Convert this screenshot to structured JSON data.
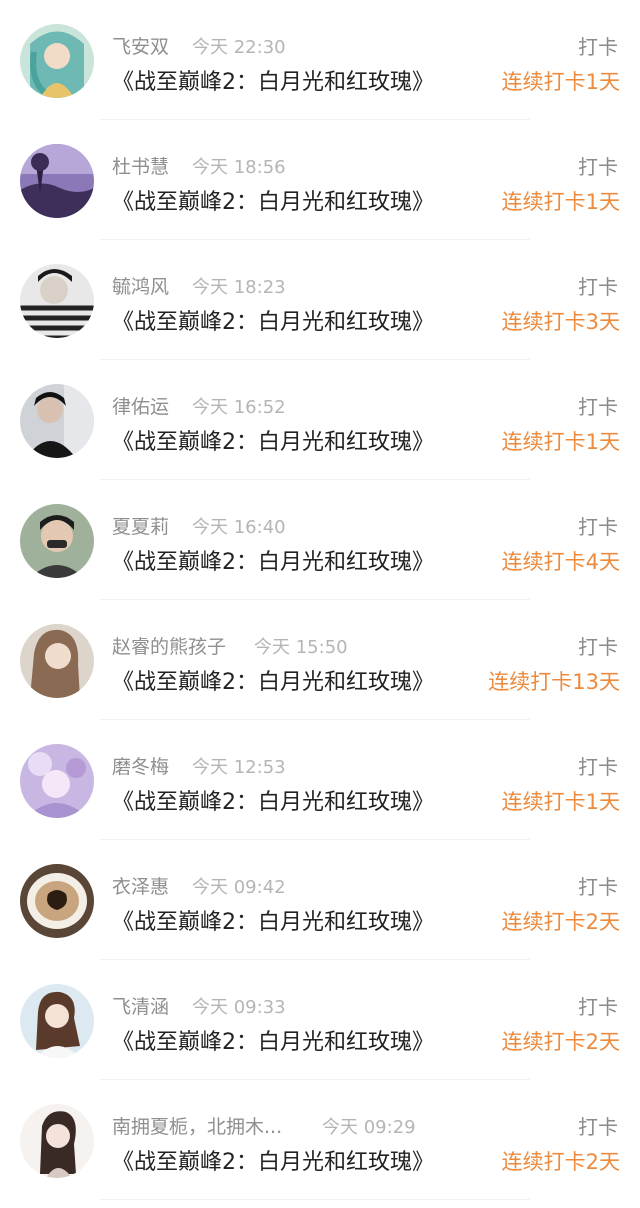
{
  "checkins": [
    {
      "name": "飞安双",
      "time": "今天 22:30",
      "type": "打卡",
      "book": "《战至巅峰2：白月光和红玫瑰》",
      "streak": "连续打卡1天"
    },
    {
      "name": "杜书慧",
      "time": "今天 18:56",
      "type": "打卡",
      "book": "《战至巅峰2：白月光和红玫瑰》",
      "streak": "连续打卡1天"
    },
    {
      "name": "毓鸿风",
      "time": "今天 18:23",
      "type": "打卡",
      "book": "《战至巅峰2：白月光和红玫瑰》",
      "streak": "连续打卡3天"
    },
    {
      "name": "律佑运",
      "time": "今天 16:52",
      "type": "打卡",
      "book": "《战至巅峰2：白月光和红玫瑰》",
      "streak": "连续打卡1天"
    },
    {
      "name": "夏夏莉",
      "time": "今天 16:40",
      "type": "打卡",
      "book": "《战至巅峰2：白月光和红玫瑰》",
      "streak": "连续打卡4天"
    },
    {
      "name": "赵睿的熊孩子",
      "time": "今天 15:50",
      "type": "打卡",
      "book": "《战至巅峰2：白月光和红玫瑰》",
      "streak": "连续打卡13天"
    },
    {
      "name": "磨冬梅",
      "time": "今天 12:53",
      "type": "打卡",
      "book": "《战至巅峰2：白月光和红玫瑰》",
      "streak": "连续打卡1天"
    },
    {
      "name": "衣泽惠",
      "time": "今天 09:42",
      "type": "打卡",
      "book": "《战至巅峰2：白月光和红玫瑰》",
      "streak": "连续打卡2天"
    },
    {
      "name": "飞清涵",
      "time": "今天 09:33",
      "type": "打卡",
      "book": "《战至巅峰2：白月光和红玫瑰》",
      "streak": "连续打卡2天"
    },
    {
      "name": "南拥夏栀，北拥木...",
      "time": "今天 09:29",
      "type": "打卡",
      "book": "《战至巅峰2：白月光和红玫瑰》",
      "streak": "连续打卡2天"
    }
  ],
  "colors": {
    "streak": "#ec8a3e",
    "name": "#8f8f8f",
    "time": "#b5b5b5",
    "book": "#222222"
  }
}
